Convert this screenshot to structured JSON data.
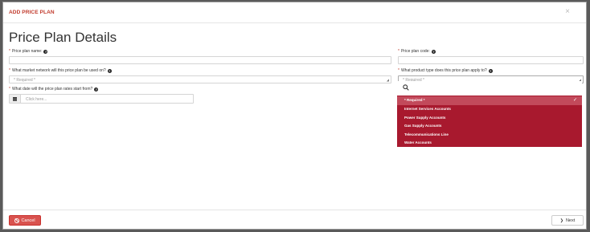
{
  "modal": {
    "title": "ADD PRICE PLAN",
    "close_glyph": "×",
    "page_title": "Price Plan Details"
  },
  "form": {
    "plan_name_label": "Price plan name:",
    "plan_code_label": "Price plan code:",
    "market_network_label": "What market network will this price plan be used on?",
    "market_network_value": "* Required *",
    "product_type_label": "What product type does this price plan apply to?",
    "product_type_value": "* Required *",
    "start_date_label": "What date will the price plan rates start from?",
    "start_date_placeholder": "Click here...",
    "required_marker": "*",
    "help_glyph": "?"
  },
  "dropdown": {
    "options": [
      {
        "label": "* Required *",
        "selected": true
      },
      {
        "label": "Internet Services Accounts",
        "selected": false
      },
      {
        "label": "Power Supply Accounts",
        "selected": false
      },
      {
        "label": "Gas Supply Accounts",
        "selected": false
      },
      {
        "label": "Telecommunications Line",
        "selected": false
      },
      {
        "label": "Water Accounts",
        "selected": false
      }
    ],
    "check_glyph": "✓",
    "search_icon": "search-icon",
    "highlight_color": "#a8192e"
  },
  "footer": {
    "cancel_label": "Cancel",
    "next_label": "Next",
    "next_glyph": "❯"
  },
  "colors": {
    "accent": "#c0392b",
    "cancel_bg": "#d9534f"
  }
}
